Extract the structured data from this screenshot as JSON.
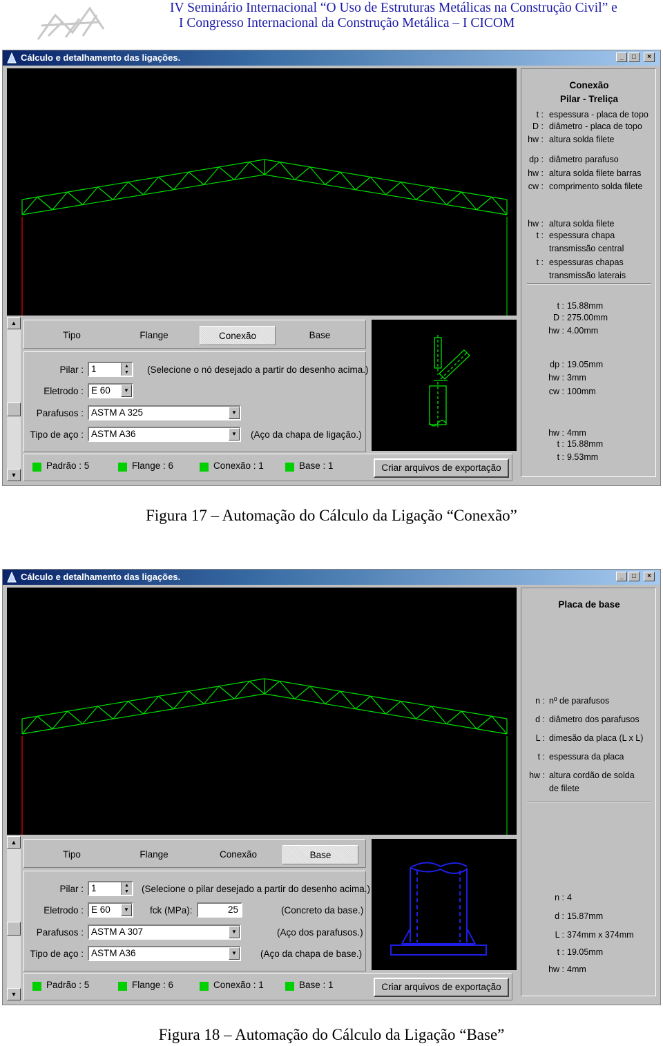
{
  "header": {
    "line1": "IV Seminário Internacional “O Uso de Estruturas Metálicas na Construção Civil” e",
    "line2": "I Congresso Internacional da Construção Metálica – I CICOM"
  },
  "windows": [
    {
      "title": "Cálculo e detalhamento das ligações.",
      "tabs": [
        "Tipo",
        "Flange",
        "Conexão",
        "Base"
      ],
      "active_tab": "Conexão",
      "pilar_label": "Pilar :",
      "pilar_value": "1",
      "pilar_hint": "(Selecione o nó desejado a partir do desenho acima.)",
      "eletrodo_label": "Eletrodo :",
      "eletrodo_value": "E 60",
      "parafusos_label": "Parafusos :",
      "parafusos_value": "ASTM A 325",
      "aco_label": "Tipo de aço :",
      "aco_value": "ASTM A36",
      "aco_hint": "(Aço da chapa de ligação.)",
      "status": [
        "Padrão : 5",
        "Flange : 6",
        "Conexão : 1",
        "Base : 1"
      ],
      "export_button": "Criar arquivos de exportação",
      "panel_title1": "Conexão",
      "panel_title2": "Pilar - Treliça",
      "legend": [
        {
          "k": "t :",
          "v": "espessura - placa de topo"
        },
        {
          "k": "D :",
          "v": "diâmetro - placa de topo"
        },
        {
          "k": "hw :",
          "v": "altura solda filete"
        },
        {
          "k": "dp :",
          "v": "diâmetro parafuso"
        },
        {
          "k": "hw :",
          "v": "altura solda filete barras"
        },
        {
          "k": "cw :",
          "v": "comprimento solda filete"
        },
        {
          "k": "hw :",
          "v": "altura solda filete"
        },
        {
          "k": "t :",
          "v": "espessura chapa"
        },
        {
          "k": "",
          "v": "transmissão central"
        },
        {
          "k": "t :",
          "v": "espessuras chapas"
        },
        {
          "k": "",
          "v": "transmissão laterais"
        }
      ],
      "values": [
        {
          "k": "t :",
          "v": "15.88mm"
        },
        {
          "k": "D :",
          "v": "275.00mm"
        },
        {
          "k": "hw :",
          "v": "4.00mm"
        },
        {
          "k": "dp :",
          "v": "19.05mm"
        },
        {
          "k": "hw :",
          "v": "3mm"
        },
        {
          "k": "cw :",
          "v": "100mm"
        },
        {
          "k": "hw :",
          "v": "4mm"
        },
        {
          "k": "t :",
          "v": "15.88mm"
        },
        {
          "k": "t :",
          "v": "9.53mm"
        }
      ]
    },
    {
      "title": "Cálculo e detalhamento das ligações.",
      "tabs": [
        "Tipo",
        "Flange",
        "Conexão",
        "Base"
      ],
      "active_tab": "Base",
      "pilar_label": "Pilar :",
      "pilar_value": "1",
      "pilar_hint": "(Selecione o pilar desejado a partir do desenho acima.)",
      "eletrodo_label": "Eletrodo :",
      "eletrodo_value": "E 60",
      "fck_label": "fck (MPa):",
      "fck_value": "25",
      "fck_hint": "(Concreto da base.)",
      "parafusos_label": "Parafusos :",
      "parafusos_value": "ASTM A 307",
      "parafusos_hint": "(Aço dos parafusos.)",
      "aco_label": "Tipo de aço :",
      "aco_value": "ASTM A36",
      "aco_hint": "(Aço da chapa de base.)",
      "status": [
        "Padrão : 5",
        "Flange : 6",
        "Conexão : 1",
        "Base : 1"
      ],
      "export_button": "Criar arquivos de exportação",
      "panel_title1": "Placa de base",
      "legend": [
        {
          "k": "n :",
          "v": "nº de parafusos"
        },
        {
          "k": "d :",
          "v": "diâmetro dos parafusos"
        },
        {
          "k": "L :",
          "v": "dimesão da placa  (L x L)"
        },
        {
          "k": "t :",
          "v": "espessura da placa"
        },
        {
          "k": "hw :",
          "v": "altura cordão de solda"
        },
        {
          "k": "",
          "v": "de filete"
        }
      ],
      "values": [
        {
          "k": "n :",
          "v": "4"
        },
        {
          "k": "d :",
          "v": "15.87mm"
        },
        {
          "k": "L :",
          "v": "374mm x 374mm"
        },
        {
          "k": "t :",
          "v": "19.05mm"
        },
        {
          "k": "hw :",
          "v": "4mm"
        }
      ]
    }
  ],
  "captions": [
    "Figura 17 – Automação do Cálculo da Ligação “Conexão”",
    "Figura 18 – Automação do Cálculo da Ligação “Base”"
  ],
  "colors": {
    "truss": "#00e000",
    "column": "#c00000",
    "base_drawing": "#1e1ee6",
    "titlebar": "#0a246a"
  }
}
